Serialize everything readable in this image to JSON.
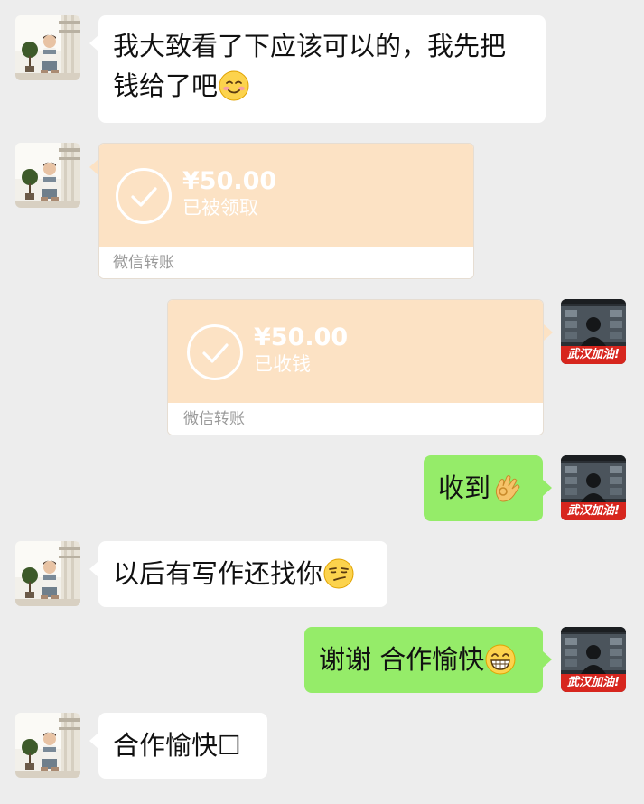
{
  "messages": [
    {
      "side": "left",
      "type": "text",
      "text_line1": "我大致看了下应该可以的，我先把",
      "text_line2": "钱给了吧",
      "emoji": "smiling-blush-emoji"
    },
    {
      "side": "left",
      "type": "transfer",
      "amount": "¥50.00",
      "status": "已被领取",
      "footer": "微信转账"
    },
    {
      "side": "right",
      "type": "transfer",
      "amount": "¥50.00",
      "status": "已收钱",
      "footer": "微信转账"
    },
    {
      "side": "right",
      "type": "text",
      "text": "收到",
      "emoji": "ok-hand-emoji"
    },
    {
      "side": "left",
      "type": "text",
      "text": "以后有写作还找你",
      "emoji": "smirk-emoji"
    },
    {
      "side": "right",
      "type": "text",
      "text": "谢谢 合作愉快",
      "emoji": "grin-emoji"
    },
    {
      "side": "left",
      "type": "text",
      "text": "合作愉快",
      "trailing_glyph": "☐"
    }
  ],
  "avatars": {
    "right_badge_text": "武汉加油!"
  },
  "colors": {
    "background": "#ededed",
    "bubble_white": "#ffffff",
    "bubble_green": "#95ec69",
    "transfer_peach": "#fce2c4",
    "badge_red": "#d7261e"
  }
}
